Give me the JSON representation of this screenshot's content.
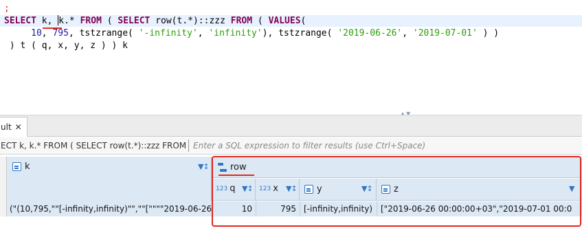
{
  "editor": {
    "line0": ";",
    "line1": {
      "kw_select": "SELECT",
      "k_comma": " k,",
      "kstar": "k.* ",
      "kw_from": "FROM",
      "paren1": " ( ",
      "kw_select2": "SELECT",
      "rowcall": " row(t.*)::zzz ",
      "kw_from2": "FROM",
      "paren2": " ( ",
      "kw_values": "VALUES",
      "paren3": "("
    },
    "line2": {
      "indent": "     ",
      "n10": "10",
      "comma1": ", ",
      "n795": "795",
      "rest1": ", tstzrange( ",
      "s_neg_inf": "'-infinity'",
      "comma2": ", ",
      "s_inf": "'infinity'",
      "rest2": "), tstzrange( ",
      "s_d1": "'2019-06-26'",
      "comma3": ", ",
      "s_d2": "'2019-07-01'",
      "rest3": " ) )"
    },
    "line3": " ) t ( q, x, y, z ) ) k"
  },
  "result_tab": {
    "label": "ult",
    "close_glyph": "✕"
  },
  "filter": {
    "query_text": "ECT k, k.* FROM ( SELECT row(t.*)::zzz FROM (",
    "placeholder": "Enter a SQL expression to filter results (use Ctrl+Space)"
  },
  "grid": {
    "columns": {
      "k": "k",
      "row": "row",
      "q": "q",
      "x": "x",
      "y": "y",
      "z": "z",
      "numeric_prefix": "123"
    },
    "rows": [
      {
        "k": "(\"(10,795,\"\"[-infinity,infinity)\"\",\"\"[\"\"\"\"2019-06-26",
        "q": "10",
        "x": "795",
        "y": "[-infinity,infinity)",
        "z": "[\"2019-06-26 00:00:00+03\",\"2019-07-01 00:0"
      }
    ]
  },
  "colors": {
    "keyword": "#7f0055",
    "string": "#2a9e0b",
    "number": "#1a1aa6",
    "highlight": "#e0281e",
    "header_bg": "#dde8f5"
  }
}
